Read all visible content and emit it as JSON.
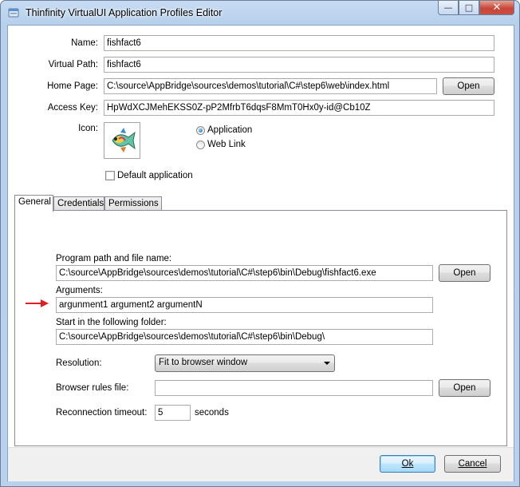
{
  "window": {
    "title": "Thinfinity VirtualUI Application Profiles Editor"
  },
  "caption_buttons": {
    "minimize": "—",
    "maximize": "□",
    "close": "✕"
  },
  "profile": {
    "name_label": "Name:",
    "name_value": "fishfact6",
    "virtual_path_label": "Virtual Path:",
    "virtual_path_value": "fishfact6",
    "home_page_label": "Home Page:",
    "home_page_value": "C:\\source\\AppBridge\\sources\\demos\\tutorial\\C#\\step6\\web\\index.html",
    "home_page_open": "Open",
    "access_key_label": "Access Key:",
    "access_key_value": "HpWdXCJMehEKSS0Z-pP2MfrbT6dqsF8MmT0Hx0y-id@Cb10Z",
    "icon_label": "Icon:",
    "icon_name": "fish-icon",
    "type_options": [
      "Application",
      "Web Link"
    ],
    "type_selected": "Application",
    "default_app_label": "Default application",
    "default_app_checked": false
  },
  "tabs": [
    "General",
    "Credentials",
    "Permissions"
  ],
  "active_tab": "General",
  "general": {
    "program_path_label": "Program path and file name:",
    "program_path_value": "C:\\source\\AppBridge\\sources\\demos\\tutorial\\C#\\step6\\bin\\Debug\\fishfact6.exe",
    "program_path_open": "Open",
    "arguments_label": "Arguments:",
    "arguments_value": "argunment1 argument2 argumentN",
    "start_folder_label": "Start in the following folder:",
    "start_folder_value": "C:\\source\\AppBridge\\sources\\demos\\tutorial\\C#\\step6\\bin\\Debug\\",
    "resolution_label": "Resolution:",
    "resolution_value": "Fit to browser window",
    "browser_rules_label": "Browser rules file:",
    "browser_rules_value": "",
    "browser_rules_open": "Open",
    "reconnection_label": "Reconnection timeout:",
    "reconnection_value": "5",
    "reconnection_unit": "seconds"
  },
  "annotation": {
    "arrow_color": "#e02020"
  },
  "buttons": {
    "ok": "Ok",
    "cancel": "Cancel"
  }
}
